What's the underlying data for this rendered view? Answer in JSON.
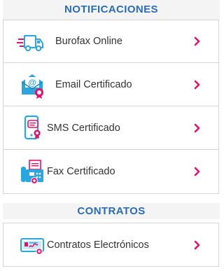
{
  "sections": [
    {
      "title": "NOTIFICACIONES"
    },
    {
      "title": "CONTRATOS"
    }
  ],
  "items": [
    {
      "label": "Burofax Online",
      "icon": "truck-icon"
    },
    {
      "label": "Email Certificado",
      "icon": "email-certified-icon"
    },
    {
      "label": "SMS Certificado",
      "icon": "sms-phone-icon"
    },
    {
      "label": "Fax Certificado",
      "icon": "fax-machine-icon"
    },
    {
      "label": "Contratos Electrónicos",
      "icon": "electronic-contract-icon"
    }
  ],
  "colors": {
    "heading": "#2b6cb8",
    "accent_blue": "#2aa6e0",
    "accent_pink": "#e5126b",
    "border": "#d6d6d6"
  }
}
